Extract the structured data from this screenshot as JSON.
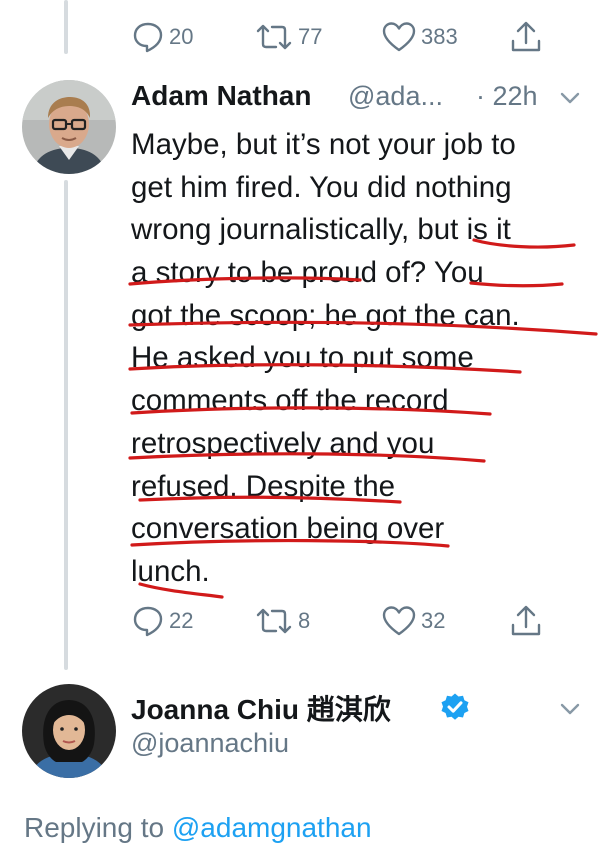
{
  "top_actions": {
    "reply_count": "20",
    "retweet_count": "77",
    "like_count": "383"
  },
  "reply_tweet": {
    "author_name": "Adam Nathan",
    "author_handle": "@ada...",
    "time": "· 22h",
    "text_lines": [
      "Maybe, but it’s not your job to",
      "get him fired. You did nothing",
      "wrong journalistically, but is it",
      "a story to be proud of? You",
      "got the scoop; he got the can.",
      "He asked you to put some",
      "comments off the record",
      "retrospectively and you",
      "refused. Despite the",
      "conversation being over",
      "lunch."
    ],
    "reply_count": "22",
    "retweet_count": "8",
    "like_count": "32"
  },
  "next_tweet": {
    "author_name": "Joanna Chiu 趙淇欣",
    "author_handle": "@joannachiu",
    "replying_prefix": "Replying to",
    "replying_mention": "@adamgnathan"
  },
  "colors": {
    "text": "#14171a",
    "secondary": "#657786",
    "link": "#1da1f2",
    "verified": "#1da1f2",
    "annotation": "#d11a1a",
    "thread_line": "#d6dbdf"
  },
  "icons": {
    "reply": "reply-icon",
    "retweet": "retweet-icon",
    "like": "heart-icon",
    "share": "share-icon",
    "menu": "chevron-down-icon",
    "verified": "verified-badge-icon"
  }
}
